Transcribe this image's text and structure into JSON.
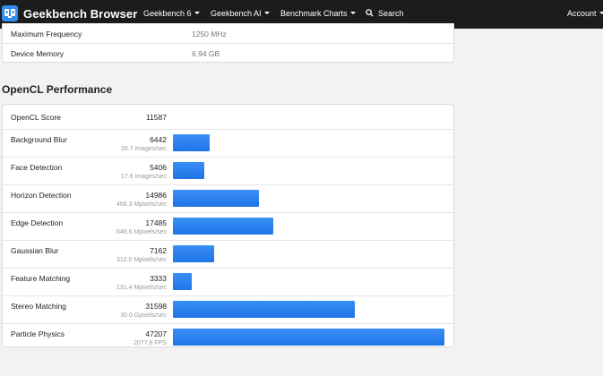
{
  "nav": {
    "brand": "Geekbench Browser",
    "items": [
      "Geekbench 6",
      "Geekbench AI",
      "Benchmark Charts"
    ],
    "search_label": "Search",
    "account_label": "Account"
  },
  "device_info": [
    {
      "label": "Maximum Frequency",
      "value": "1250 MHz"
    },
    {
      "label": "Device Memory",
      "value": "6.94 GB"
    }
  ],
  "opencl": {
    "title": "OpenCL Performance",
    "score_label": "OpenCL Score",
    "score_value": "11587",
    "max_score": 47207,
    "tests": [
      {
        "name": "Background Blur",
        "score": "6442",
        "rate": "26.7 images/sec"
      },
      {
        "name": "Face Detection",
        "score": "5406",
        "rate": "17.6 images/sec"
      },
      {
        "name": "Horizon Detection",
        "score": "14986",
        "rate": "466.3 Mpixels/sec"
      },
      {
        "name": "Edge Detection",
        "score": "17485",
        "rate": "648.6 Mpixels/sec"
      },
      {
        "name": "Gaussian Blur",
        "score": "7162",
        "rate": "312.0 Mpixels/sec"
      },
      {
        "name": "Feature Matching",
        "score": "3333",
        "rate": "131.4 Mpixels/sec"
      },
      {
        "name": "Stereo Matching",
        "score": "31598",
        "rate": "30.0 Gpixels/sec"
      },
      {
        "name": "Particle Physics",
        "score": "47207",
        "rate": "2077.6 FPS"
      }
    ]
  },
  "colors": {
    "navbar": "#1c1c1c",
    "bar": "#2b82f0",
    "page_bg": "#f2f2f2"
  }
}
